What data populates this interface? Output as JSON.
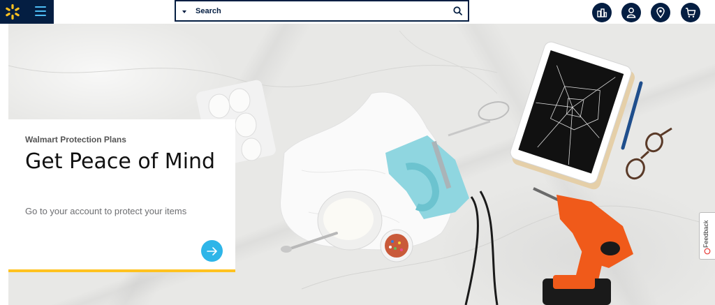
{
  "header": {
    "search": {
      "placeholder": "Search"
    },
    "icons": [
      "spark-logo-icon",
      "menu-icon",
      "search-icon",
      "departments-icon",
      "account-icon",
      "store-location-icon",
      "cart-icon"
    ]
  },
  "promo": {
    "eyebrow": "Walmart Protection Plans",
    "headline": "Get Peace of Mind",
    "subtext": "Go to your account to protect your items"
  },
  "feedback": {
    "label": "Feedback"
  },
  "colors": {
    "navy": "#041e42",
    "accent_blue": "#2eb5e8",
    "light_blue": "#4dbdf5",
    "yellow": "#ffc220",
    "drill_orange": "#f05a1a",
    "mixer_aqua": "#8fd6e0"
  }
}
